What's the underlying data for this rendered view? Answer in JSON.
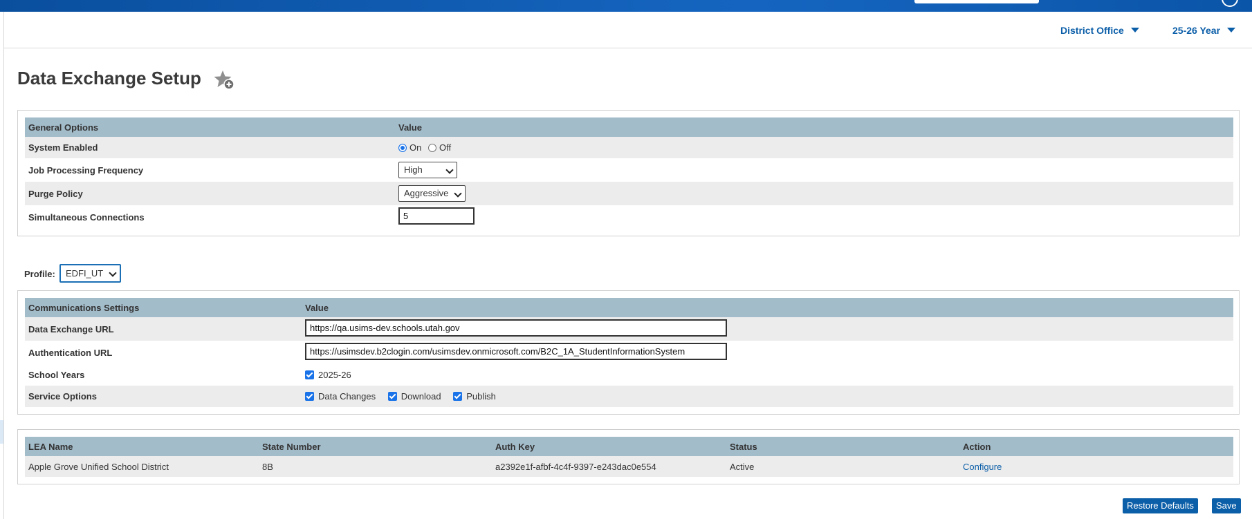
{
  "header": {
    "district_selector": "District Office",
    "year_selector": "25-26 Year"
  },
  "page": {
    "title": "Data Exchange Setup"
  },
  "general_options": {
    "col_option": "General Options",
    "col_value": "Value",
    "system_enabled": {
      "label": "System Enabled",
      "on_label": "On",
      "off_label": "Off",
      "selected": "On"
    },
    "job_frequency": {
      "label": "Job Processing Frequency",
      "value": "High"
    },
    "purge_policy": {
      "label": "Purge Policy",
      "value": "Aggressive"
    },
    "simultaneous_connections": {
      "label": "Simultaneous Connections",
      "value": "5"
    }
  },
  "profile": {
    "label": "Profile:",
    "value": "EDFI_UT"
  },
  "communications": {
    "col_setting": "Communications Settings",
    "col_value": "Value",
    "data_exchange_url": {
      "label": "Data Exchange URL",
      "value": "https://qa.usims-dev.schools.utah.gov"
    },
    "authentication_url": {
      "label": "Authentication URL",
      "value": "https://usimsdev.b2clogin.com/usimsdev.onmicrosoft.com/B2C_1A_StudentInformationSystem"
    },
    "school_years": {
      "label": "School Years",
      "options": [
        {
          "label": "2025-26",
          "checked": true
        }
      ]
    },
    "service_options": {
      "label": "Service Options",
      "options": [
        {
          "label": "Data Changes",
          "checked": true
        },
        {
          "label": "Download",
          "checked": true
        },
        {
          "label": "Publish",
          "checked": true
        }
      ]
    }
  },
  "lea_table": {
    "headers": [
      "LEA Name",
      "State Number",
      "Auth Key",
      "Status",
      "Action"
    ],
    "rows": [
      {
        "lea_name": "Apple Grove Unified School District",
        "state_number": "8B",
        "auth_key": "a2392e1f-afbf-4c4f-9397-e243dac0e554",
        "status": "Active",
        "action": "Configure"
      }
    ]
  },
  "buttons": {
    "restore_defaults": "Restore Defaults",
    "save": "Save"
  },
  "colors": {
    "accent": "#0b5ea8",
    "table_header": "#a3bcca",
    "row_shade": "#ececec",
    "topbar": "#1565c0"
  }
}
